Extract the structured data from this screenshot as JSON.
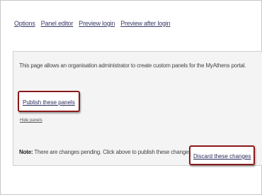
{
  "tabs": [
    {
      "label": "Options"
    },
    {
      "label": "Panel editor"
    },
    {
      "label": "Preview login"
    },
    {
      "label": "Preview after login"
    }
  ],
  "panel": {
    "intro_text": "This page allows an organisation administrator to create custom panels for the MyAthens portal.",
    "publish_label": "Publish these panels",
    "sub_link_label": "Hide panels",
    "note_label": "Note:",
    "note_text": " There are changes pending. Click above to publish these changes.",
    "discard_label": "Discard these changes"
  },
  "colors": {
    "highlight_border": "#8b1a1a",
    "link": "#2a2a5a",
    "panel_background": "#f4f4f4"
  }
}
